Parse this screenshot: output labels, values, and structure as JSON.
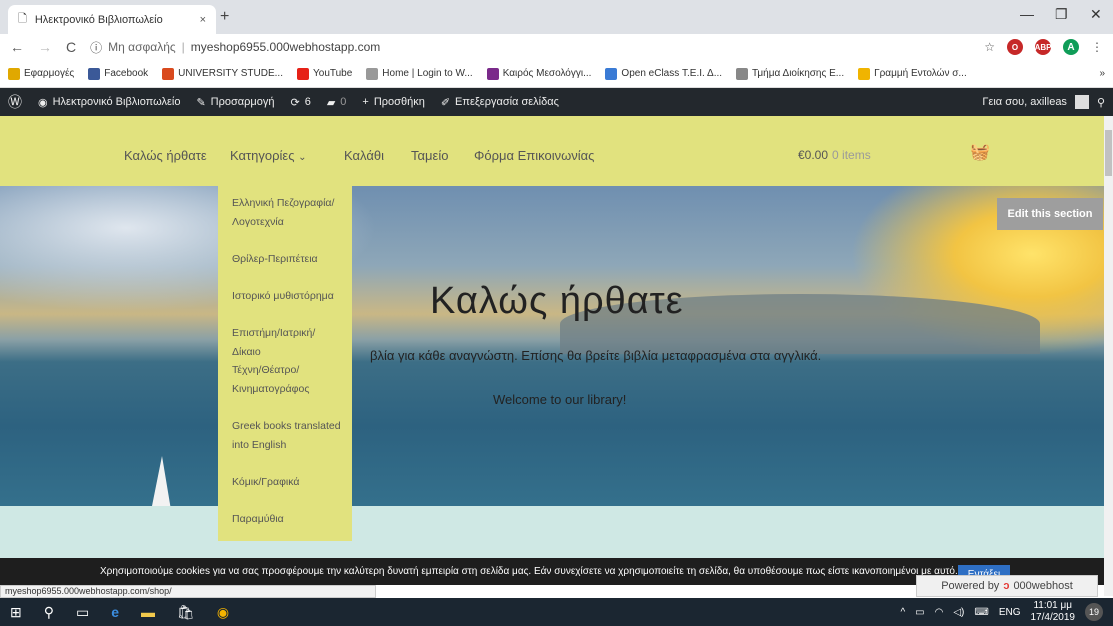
{
  "browser": {
    "tab_title": "Ηλεκτρονικό Βιβλιοπωλείο",
    "tab_close": "×",
    "new_tab": "+",
    "address_security": "Μη ασφαλής",
    "address_url": "myeshop6955.000webhostapp.com",
    "profile_initial": "A",
    "abp_label": "ABP",
    "bookmarks_overflow": "»",
    "status_url": "myeshop6955.000webhostapp.com/shop/"
  },
  "bookmarks": [
    {
      "label": "Εφαρμογές",
      "color": "#e0a800"
    },
    {
      "label": "Facebook",
      "color": "#3b5998"
    },
    {
      "label": "UNIVERSITY STUDE...",
      "color": "#d94a1e"
    },
    {
      "label": "YouTube",
      "color": "#e62117"
    },
    {
      "label": "Home | Login to W...",
      "color": "#999999"
    },
    {
      "label": "Καιρός Μεσολόγγι...",
      "color": "#7a2a8a"
    },
    {
      "label": "Open eClass Τ.Ε.Ι. Δ...",
      "color": "#3a7bd5"
    },
    {
      "label": "Τμήμα Διοίκησης Ε...",
      "color": "#888888"
    },
    {
      "label": "Γραμμή Εντολών σ...",
      "color": "#f0b400"
    }
  ],
  "adminbar": {
    "site_name": "Ηλεκτρονικό Βιβλιοπωλείο",
    "customize": "Προσαρμογή",
    "updates_count": "6",
    "comments_count": "0",
    "add_new": "Προσθήκη",
    "edit_page": "Επεξεργασία σελίδας",
    "greeting": "Γεια σου, axilleas"
  },
  "nav": {
    "welcome": "Καλώς ήρθατε",
    "categories": "Κατηγορίες",
    "cart": "Καλάθι",
    "checkout": "Ταμείο",
    "contact": "Φόρμα Επικοινωνίας",
    "cart_total": "€0.00",
    "cart_items": "0 items"
  },
  "dropdown": [
    "Ελληνική Πεζογραφία/",
    "Λογοτεχνία",
    "Θρίλερ-Περιπέτεια",
    "Ιστορικό μυθιστόρημα",
    "Επιστήμη/Ιατρική/Δίκαιο",
    "Τέχνη/Θέατρο/",
    "Κινηματογράφος",
    "Greek books translated",
    "into English",
    "Κόμικ/Γραφικά",
    "Παραμύθια"
  ],
  "hero": {
    "title": "Καλώς ήρθατε",
    "subtitle": "βλία για κάθε αναγνώστη. Επίσης θα βρείτε βιβλία μεταφρασμένα στα αγγλικά.",
    "welcome": "Welcome to our library!",
    "edit_section": "Edit this section"
  },
  "cookie": {
    "text": "Χρησιμοποιούμε cookies για να σας προσφέρουμε την καλύτερη δυνατή εμπειρία στη σελίδα μας. Εάν συνεχίσετε να χρησιμοποιείτε τη σελίδα, θα υποθέσουμε πως είστε ικανοποιημένοι με αυτό.",
    "accept": "Εντάξει",
    "powered": "Powered by",
    "host": "000webhost"
  },
  "taskbar": {
    "lang": "ENG",
    "time": "11:01 μμ",
    "date": "17/4/2019",
    "notifications": "19"
  }
}
